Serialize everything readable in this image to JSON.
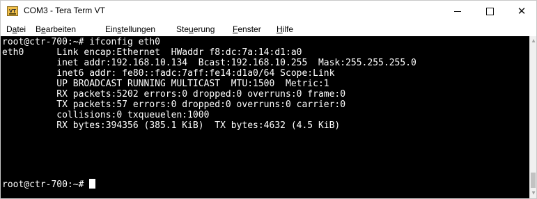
{
  "window": {
    "title": "COM3 - Tera Term VT",
    "icon_name": "tera-term-app-icon",
    "controls": {
      "minimize": "minimize-icon",
      "maximize": "maximize-icon",
      "close": "close-icon",
      "close_glyph": "✕"
    }
  },
  "menu": {
    "items": [
      {
        "pre": "D",
        "u": "a",
        "post": "tei"
      },
      {
        "pre": "B",
        "u": "e",
        "post": "arbeiten"
      },
      {
        "pre": "Ein",
        "u": "s",
        "post": "tellungen"
      },
      {
        "pre": "Ste",
        "u": "u",
        "post": "erung"
      },
      {
        "pre": "",
        "u": "F",
        "post": "enster"
      },
      {
        "pre": "",
        "u": "H",
        "post": "ilfe"
      }
    ]
  },
  "terminal": {
    "lines": [
      "root@ctr-700:~# ifconfig eth0",
      "eth0      Link encap:Ethernet  HWaddr f8:dc:7a:14:d1:a0",
      "          inet addr:192.168.10.134  Bcast:192.168.10.255  Mask:255.255.255.0",
      "          inet6 addr: fe80::fadc:7aff:fe14:d1a0/64 Scope:Link",
      "          UP BROADCAST RUNNING MULTICAST  MTU:1500  Metric:1",
      "          RX packets:5202 errors:0 dropped:0 overruns:0 frame:0",
      "          TX packets:57 errors:0 dropped:0 overruns:0 carrier:0",
      "          collisions:0 txqueuelen:1000",
      "          RX bytes:394356 (385.1 KiB)  TX bytes:4632 (4.5 KiB)",
      "",
      "root@ctr-700:~# "
    ]
  },
  "colors": {
    "terminal_bg": "#000000",
    "terminal_fg": "#ffffff"
  }
}
